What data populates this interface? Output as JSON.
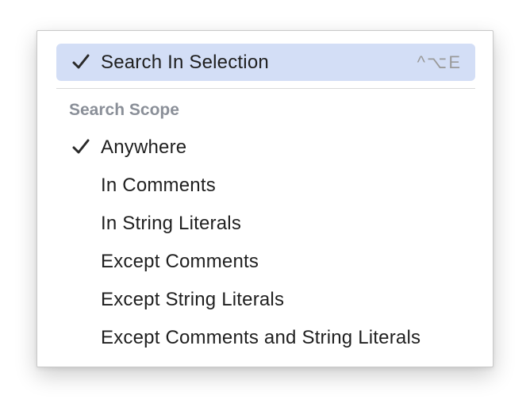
{
  "menu": {
    "search_in_selection": {
      "label": "Search In Selection",
      "shortcut": "^⌥E",
      "checked": true,
      "highlighted": true
    },
    "section_header": "Search Scope",
    "scope_items": [
      {
        "label": "Anywhere",
        "checked": true
      },
      {
        "label": "In Comments",
        "checked": false
      },
      {
        "label": "In String Literals",
        "checked": false
      },
      {
        "label": "Except Comments",
        "checked": false
      },
      {
        "label": "Except String Literals",
        "checked": false
      },
      {
        "label": "Except Comments and String Literals",
        "checked": false
      }
    ],
    "colors": {
      "highlight": "#d3def6",
      "text": "#1f1f1f",
      "header": "#8a8f98",
      "shortcut": "#9a9a9a"
    },
    "check_icon": "checkmark-icon"
  }
}
